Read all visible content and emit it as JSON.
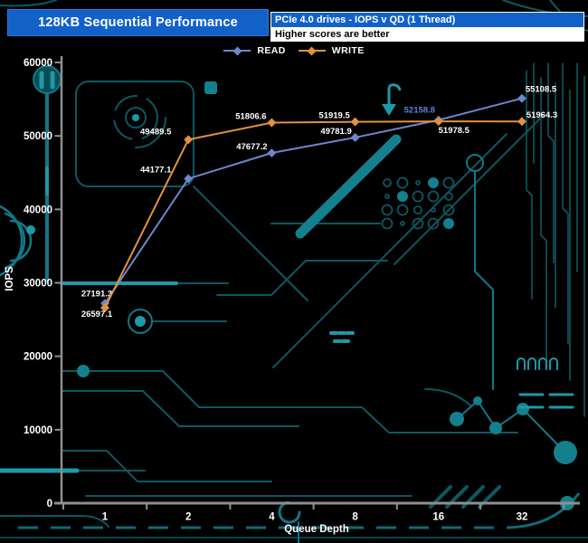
{
  "header": {
    "title": "128KB Sequential Performance",
    "subtitle": "PCIe 4.0 drives - IOPS v QD (1 Thread)",
    "note": "Higher scores are better"
  },
  "legend": [
    {
      "label": "READ",
      "color": "#6d87cd"
    },
    {
      "label": "WRITE",
      "color": "#e2923e"
    }
  ],
  "chart_data": {
    "type": "line",
    "categories": [
      "1",
      "2",
      "4",
      "8",
      "16",
      "32"
    ],
    "x_values": [
      1,
      2,
      4,
      8,
      16,
      32
    ],
    "series": [
      {
        "name": "READ",
        "color": "#6d87cd",
        "values": [
          27191.3,
          44177.1,
          47677.2,
          49781.9,
          52158.8,
          55108.5
        ]
      },
      {
        "name": "WRITE",
        "color": "#e2923e",
        "values": [
          26597.1,
          49489.5,
          51806.6,
          51919.5,
          51978.5,
          51964.3
        ]
      }
    ],
    "xlabel": "Queue Depth",
    "ylabel": "IOPS",
    "ylim": [
      0,
      60000
    ],
    "ytick_step": 10000,
    "yticks": [
      "0",
      "10000",
      "20000",
      "30000",
      "40000",
      "50000",
      "60000"
    ],
    "grid": "off",
    "legend_position": "top-center",
    "highlight_label": {
      "series": "READ",
      "index": 4,
      "color": "#5b83d8"
    },
    "label_color": "#ffffff",
    "axis_color": "#8f8f8f"
  }
}
